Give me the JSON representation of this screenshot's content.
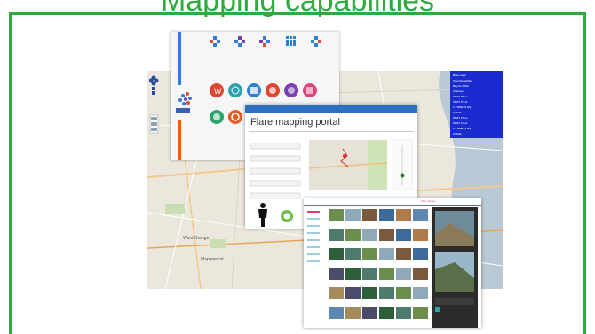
{
  "slide": {
    "title": "Mapping capabilities",
    "accent_color": "#2eaa3e"
  },
  "portal": {
    "title": "Flare mapping portal"
  },
  "map": {
    "base_layer_title": "Base Layer",
    "base_layers": [
      "OpenStreetMap",
      "Bicycle WMS"
    ],
    "overlays_title": "Overlays",
    "overlays": [
      "SMAT Photo",
      "SMAT Track",
      "1-TWEETS EQ",
      "FLARE",
      "SMAT Photo",
      "SMAT Track",
      "1-TWEETS EQ",
      "FLARE"
    ]
  },
  "gallery": {
    "header_link": "Flare Viewer"
  }
}
